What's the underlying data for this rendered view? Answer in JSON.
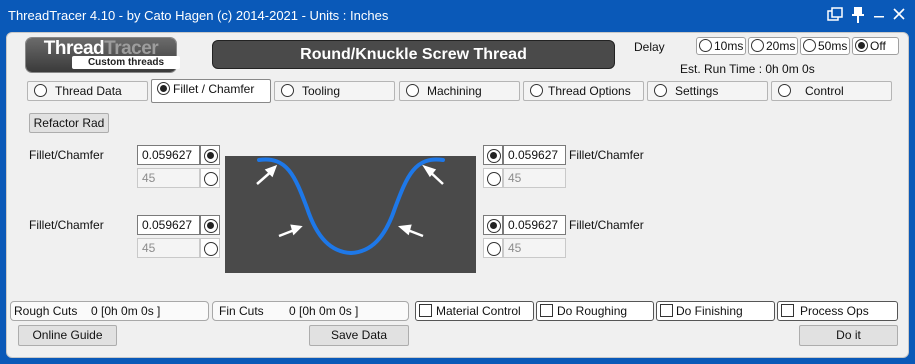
{
  "window": {
    "title": "ThreadTracer 4.10 - by Cato Hagen (c) 2014-2021 - Units : Inches",
    "controls": [
      "window-restore-icon",
      "pin-icon",
      "minimize-icon",
      "close-icon"
    ]
  },
  "logo": {
    "main": "ThreadTracer",
    "main_a": "Thread",
    "main_b": "Tracer",
    "sub": "Custom threads"
  },
  "banner": {
    "title": "Round/Knuckle Screw Thread"
  },
  "delay": {
    "label": "Delay",
    "options": [
      "10ms",
      "20ms",
      "50ms",
      "Off"
    ],
    "selected": "Off",
    "run_time": "Est. Run Time : 0h 0m 0s"
  },
  "tabs": [
    {
      "label": "Thread Data",
      "active": false
    },
    {
      "label": "Fillet / Chamfer",
      "active": true
    },
    {
      "label": "Tooling",
      "active": false
    },
    {
      "label": "Machining",
      "active": false
    },
    {
      "label": "Thread Options",
      "active": false
    },
    {
      "label": "Settings",
      "active": false
    },
    {
      "label": "Control",
      "active": false
    }
  ],
  "refactor_button": "Refactor Rad",
  "fillets": {
    "top_left": {
      "label": "Fillet/Chamfer",
      "value": "0.059627",
      "angle": "45"
    },
    "bottom_left": {
      "label": "Fillet/Chamfer",
      "value": "0.059627",
      "angle": "45"
    },
    "top_right": {
      "label": "Fillet/Chamfer",
      "value": "0.059627",
      "angle": "45"
    },
    "bottom_right": {
      "label": "Fillet/Chamfer",
      "value": "0.059627",
      "angle": "45"
    }
  },
  "status": {
    "rough_label": "Rough Cuts",
    "rough_value": "0 [0h 0m 0s ]",
    "fin_label": "Fin Cuts",
    "fin_value": "0 [0h 0m 0s ]"
  },
  "checkboxes": [
    "Material Control",
    "Do Roughing",
    "Do Finishing",
    "Process Ops"
  ],
  "buttons": {
    "online_guide": "Online Guide",
    "save_data": "Save Data",
    "do_it": "Do it"
  },
  "colors": {
    "titlebar": "#0a59b8",
    "curve": "#1e78e8",
    "preview_bg": "#4a4a4a"
  }
}
